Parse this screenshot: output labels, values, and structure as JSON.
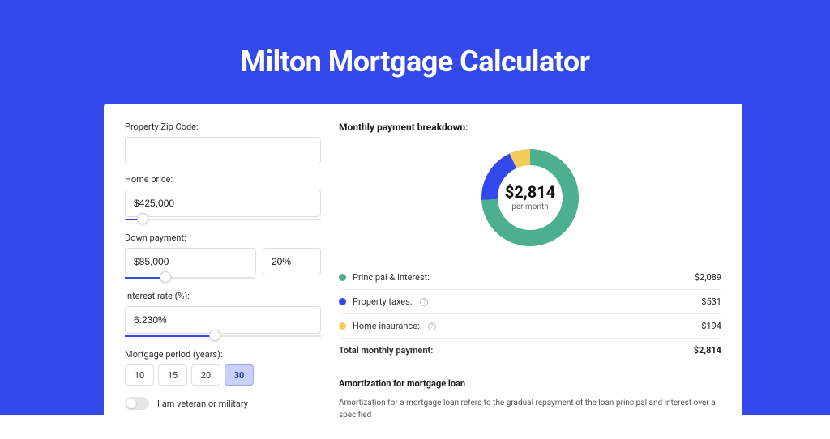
{
  "title": "Milton Mortgage Calculator",
  "form": {
    "zip": {
      "label": "Property Zip Code:",
      "value": ""
    },
    "home_price": {
      "label": "Home price:",
      "value": "$425,000",
      "slider_pct": 9
    },
    "down_payment": {
      "label": "Down payment:",
      "amount": "$85,000",
      "percent": "20%",
      "slider_pct": 31
    },
    "interest_rate": {
      "label": "Interest rate (%):",
      "value": "6.230%",
      "slider_pct": 46
    },
    "mortgage_period": {
      "label": "Mortgage period (years):",
      "options": [
        "10",
        "15",
        "20",
        "30"
      ],
      "selected": "30"
    },
    "veteran": {
      "label": "I am veteran or military"
    }
  },
  "breakdown": {
    "title": "Monthly payment breakdown:",
    "center_value": "$2,814",
    "center_sub": "per month",
    "items": [
      {
        "label": "Principal & Interest:",
        "value": "$2,089",
        "color": "#4caf8f",
        "info": false
      },
      {
        "label": "Property taxes:",
        "value": "$531",
        "color": "#3349ec",
        "info": true
      },
      {
        "label": "Home insurance:",
        "value": "$194",
        "color": "#f4cc5b",
        "info": true
      }
    ],
    "total": {
      "label": "Total monthly payment:",
      "value": "$2,814"
    }
  },
  "amortization": {
    "title": "Amortization for mortgage loan",
    "text": "Amortization for a mortgage loan refers to the gradual repayment of the loan principal and interest over a specified"
  },
  "chart_data": {
    "type": "pie",
    "title": "Monthly payment breakdown",
    "series": [
      {
        "name": "Principal & Interest",
        "value": 2089,
        "color": "#4caf8f"
      },
      {
        "name": "Property taxes",
        "value": 531,
        "color": "#3349ec"
      },
      {
        "name": "Home insurance",
        "value": 194,
        "color": "#f4cc5b"
      }
    ],
    "total": 2814,
    "unit": "USD per month"
  }
}
